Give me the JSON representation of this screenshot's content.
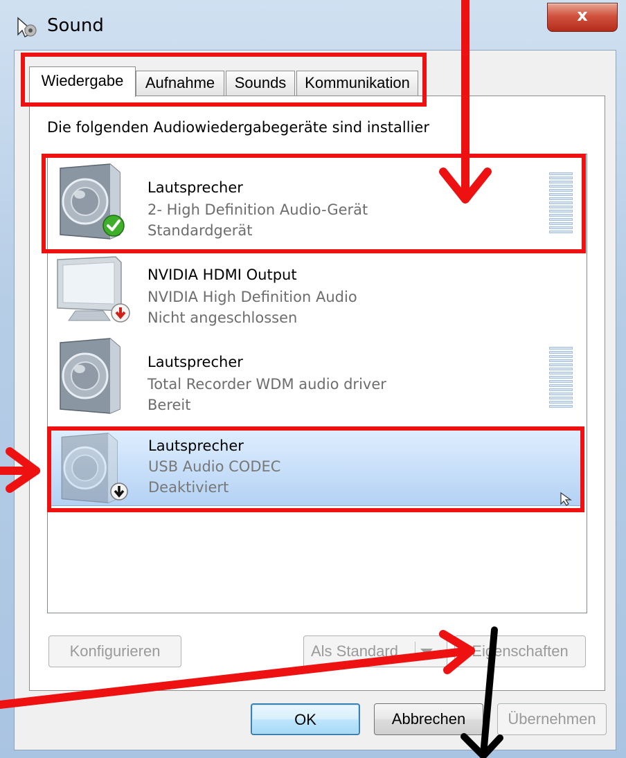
{
  "window": {
    "title": "Sound",
    "close_glyph": "x"
  },
  "tabs": [
    {
      "label": "Wiedergabe",
      "active": true
    },
    {
      "label": "Aufnahme",
      "active": false
    },
    {
      "label": "Sounds",
      "active": false
    },
    {
      "label": "Kommunikation",
      "active": false
    }
  ],
  "instruction": "Die folgenden Audiowiedergabegeräte sind installier",
  "devices": [
    {
      "name": "Lautsprecher",
      "driver": "2- High Definition Audio-Gerät",
      "status": "Standardgerät",
      "icon": "speaker-icon",
      "badge": "green-check-icon",
      "level_meter": true,
      "selected": false
    },
    {
      "name": "NVIDIA HDMI Output",
      "driver": "NVIDIA High Definition Audio",
      "status": "Nicht angeschlossen",
      "icon": "monitor-icon",
      "badge": "red-down-arrow-icon",
      "level_meter": false,
      "selected": false
    },
    {
      "name": "Lautsprecher",
      "driver": "Total Recorder WDM audio driver",
      "status": "Bereit",
      "icon": "speaker-icon",
      "badge": "",
      "level_meter": true,
      "selected": false
    },
    {
      "name": "Lautsprecher",
      "driver": "USB Audio CODEC",
      "status": "Deaktiviert",
      "icon": "speaker-icon",
      "badge": "black-down-arrow-icon",
      "level_meter": false,
      "selected": true
    }
  ],
  "buttons": {
    "configure": "Konfigurieren",
    "set_default": "Als Standard",
    "properties": "Eigenschaften",
    "ok": "OK",
    "cancel": "Abbrechen",
    "apply": "Übernehmen"
  },
  "colors": {
    "annotation_red": "#ee1111",
    "annotation_black": "#000000",
    "selection": "#c5ddf8"
  }
}
